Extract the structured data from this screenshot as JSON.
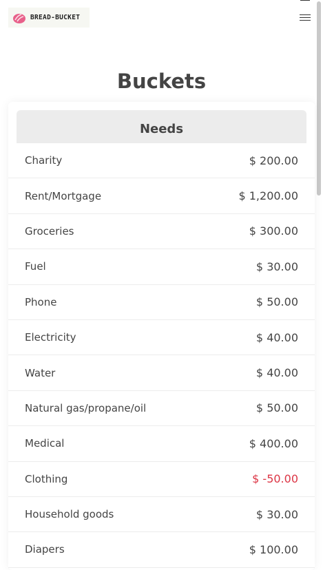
{
  "brand": {
    "name": "BREAD-BUCKET"
  },
  "page": {
    "title": "Buckets"
  },
  "section": {
    "title": "Needs",
    "items": [
      {
        "name": "Charity",
        "amount": "$ 200.00",
        "negative": false
      },
      {
        "name": "Rent/Mortgage",
        "amount": "$ 1,200.00",
        "negative": false
      },
      {
        "name": "Groceries",
        "amount": "$ 300.00",
        "negative": false
      },
      {
        "name": "Fuel",
        "amount": "$ 30.00",
        "negative": false
      },
      {
        "name": "Phone",
        "amount": "$ 50.00",
        "negative": false
      },
      {
        "name": "Electricity",
        "amount": "$ 40.00",
        "negative": false
      },
      {
        "name": "Water",
        "amount": "$ 40.00",
        "negative": false
      },
      {
        "name": "Natural gas/propane/oil",
        "amount": "$ 50.00",
        "negative": false
      },
      {
        "name": "Medical",
        "amount": "$ 400.00",
        "negative": false
      },
      {
        "name": "Clothing",
        "amount": "$ -50.00",
        "negative": true
      },
      {
        "name": "Household goods",
        "amount": "$ 30.00",
        "negative": false
      },
      {
        "name": "Diapers",
        "amount": "$ 100.00",
        "negative": false
      }
    ]
  },
  "colors": {
    "negative": "#dc3545",
    "logo": "#e8608a"
  },
  "icons": {
    "brand": "bread-icon",
    "menu": "hamburger-menu-icon"
  }
}
